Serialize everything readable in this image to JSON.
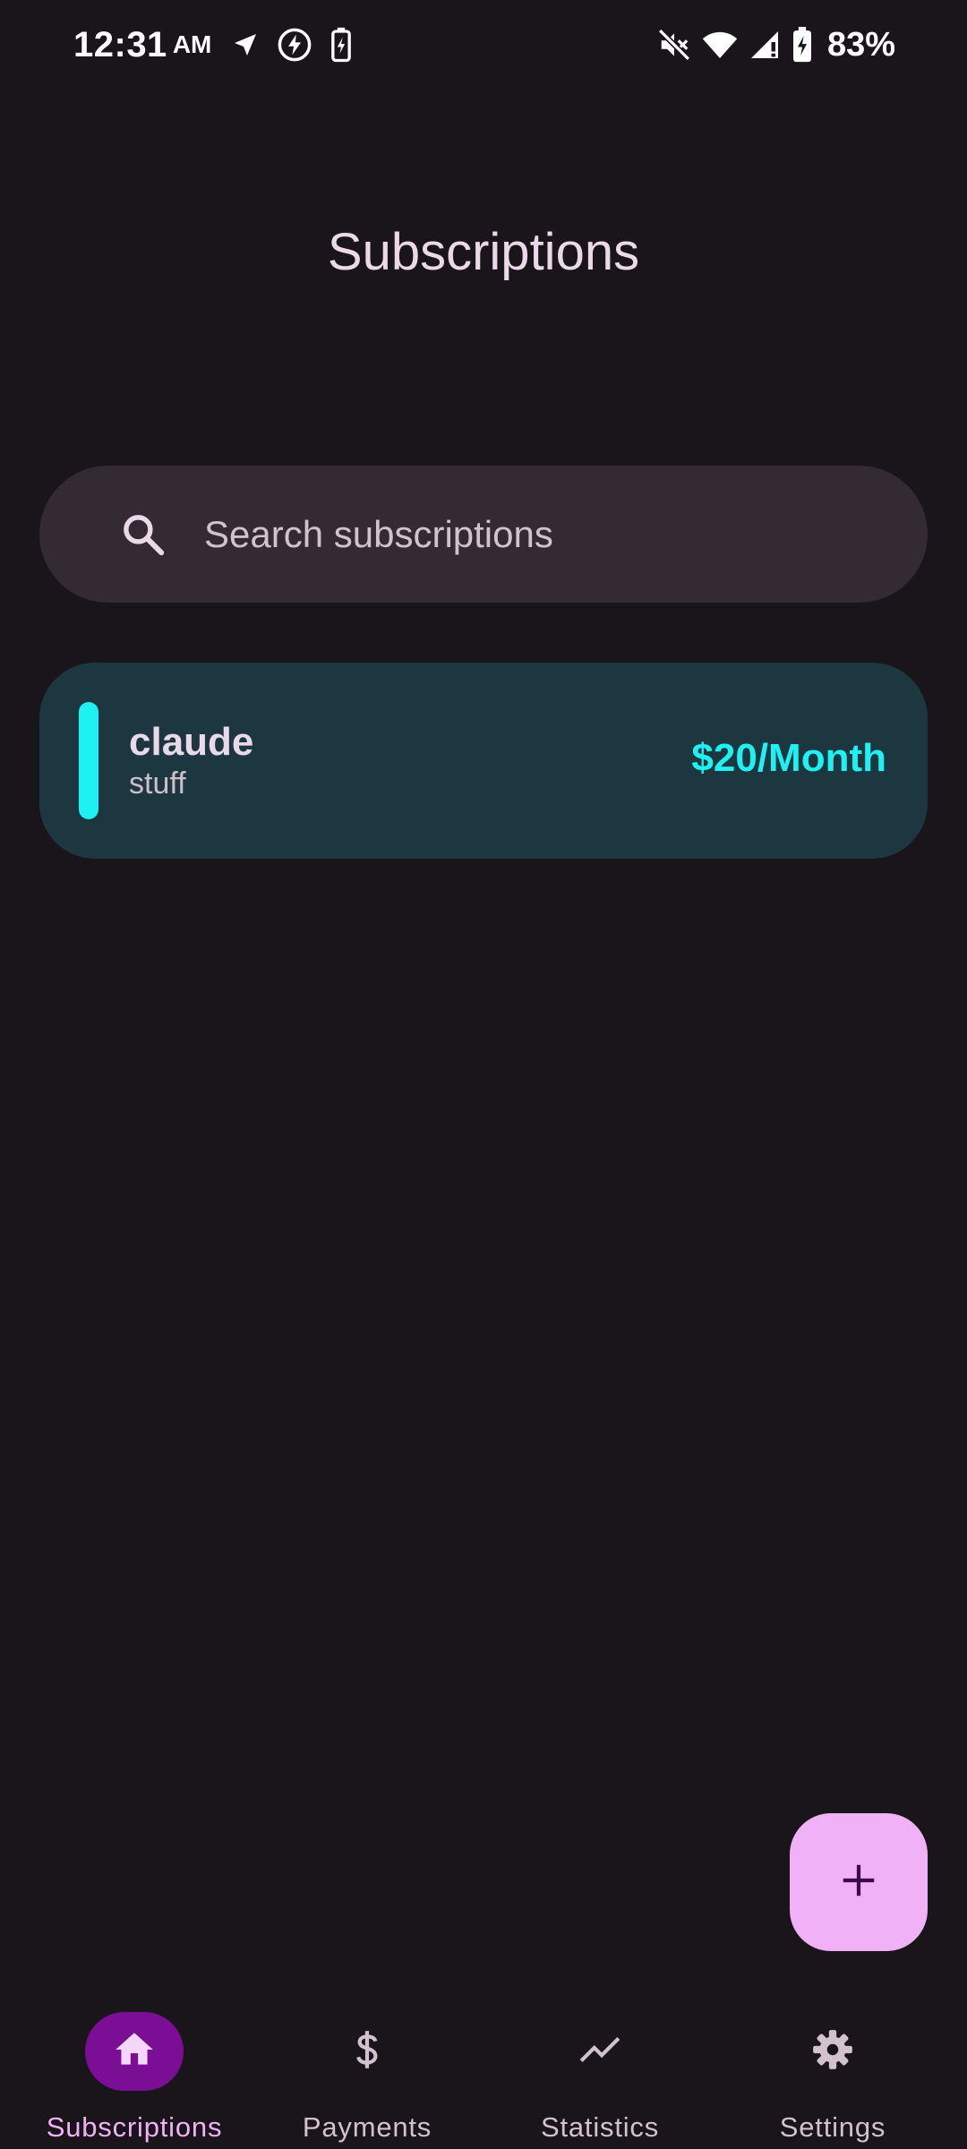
{
  "status_bar": {
    "time": "12:31",
    "ampm": "AM",
    "battery": "83%",
    "icons_left": [
      "navigation-icon",
      "data-saver-icon",
      "battery-saver-icon"
    ],
    "icons_right": [
      "mute-icon",
      "wifi-icon",
      "signal-icon",
      "battery-charging-icon"
    ]
  },
  "page": {
    "title": "Subscriptions"
  },
  "search": {
    "placeholder": "Search subscriptions",
    "icon": "search-icon"
  },
  "subscriptions": [
    {
      "name": "claude",
      "description": "stuff",
      "price": "$20/Month",
      "color": "#1ef1f1"
    }
  ],
  "fab": {
    "icon": "plus-icon",
    "color": "#f1b1f6"
  },
  "bottom_nav": {
    "items": [
      {
        "label": "Subscriptions",
        "icon": "home-icon",
        "active": true
      },
      {
        "label": "Payments",
        "icon": "dollar-icon",
        "active": false
      },
      {
        "label": "Statistics",
        "icon": "trending-icon",
        "active": false
      },
      {
        "label": "Settings",
        "icon": "gear-icon",
        "active": false
      }
    ]
  },
  "colors": {
    "background": "#1a141b",
    "search_bg": "#332a33",
    "card_bg": "#1c3740",
    "accent": "#1ef1f1",
    "primary": "#f1b1f6",
    "nav_active_pill": "#7a0f96"
  }
}
